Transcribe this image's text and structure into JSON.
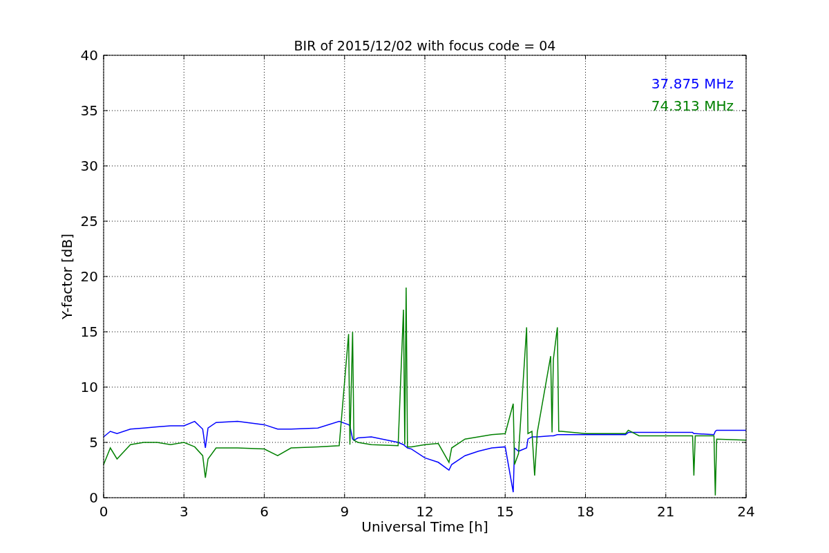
{
  "chart_data": {
    "type": "line",
    "title": "BIR of 2015/12/02 with focus code = 04",
    "xlabel": "Universal Time [h]",
    "ylabel": "Y-factor [dB]",
    "xlim": [
      0,
      24
    ],
    "ylim": [
      0,
      40
    ],
    "xticks": [
      0,
      3,
      6,
      9,
      12,
      15,
      18,
      21,
      24
    ],
    "yticks": [
      0,
      5,
      10,
      15,
      20,
      25,
      30,
      35,
      40
    ],
    "grid": true,
    "x": [
      0,
      0.25,
      0.5,
      1,
      1.5,
      2,
      2.5,
      3,
      3.4,
      3.7,
      3.8,
      3.9,
      4.2,
      5,
      6,
      6.5,
      7,
      8,
      8.8,
      9.15,
      9.2,
      9.3,
      9.35,
      9.5,
      10,
      11,
      11.2,
      11.25,
      11.3,
      11.35,
      11.5,
      12,
      12.5,
      12.9,
      13,
      13.5,
      14,
      14.5,
      15,
      15.3,
      15.35,
      15.5,
      15.8,
      15.85,
      16,
      16.1,
      16.2,
      16.7,
      16.75,
      16.8,
      16.95,
      17,
      17.1,
      18,
      19.5,
      19.6,
      20,
      21,
      22,
      22.05,
      22.1,
      22.8,
      22.85,
      22.9,
      24
    ],
    "series": [
      {
        "name": "37.875 MHz",
        "color": "#0000ff",
        "values": [
          5.5,
          6,
          5.8,
          6.2,
          6.3,
          6.4,
          6.5,
          6.5,
          6.9,
          6.2,
          4.5,
          6.3,
          6.8,
          6.9,
          6.6,
          6.2,
          6.2,
          6.3,
          6.9,
          6.6,
          6.5,
          5.3,
          5.2,
          5.4,
          5.5,
          5,
          4.8,
          4.7,
          4.6,
          4.5,
          4.4,
          3.6,
          3.2,
          2.5,
          3,
          3.8,
          4.2,
          4.5,
          4.6,
          0.5,
          4.5,
          4.2,
          4.5,
          5.3,
          5.5,
          5.5,
          5.5,
          5.6,
          5.6,
          5.6,
          5.7,
          5.7,
          5.7,
          5.7,
          5.7,
          5.9,
          5.9,
          5.9,
          5.9,
          5.8,
          5.8,
          5.7,
          6,
          6.1,
          6.1
        ]
      },
      {
        "name": "74.313 MHz",
        "color": "#008000",
        "values": [
          3,
          4.5,
          3.5,
          4.8,
          5,
          5,
          4.8,
          5,
          4.6,
          3.8,
          1.8,
          3.5,
          4.5,
          4.5,
          4.4,
          3.8,
          4.5,
          4.6,
          4.7,
          14.8,
          4.8,
          15,
          5.2,
          5,
          4.8,
          4.7,
          17,
          4.8,
          19,
          4.6,
          4.6,
          4.8,
          4.9,
          3.2,
          4.5,
          5.3,
          5.5,
          5.7,
          5.8,
          8.5,
          3,
          4,
          15.4,
          5.8,
          6,
          2,
          5.9,
          12.8,
          5.9,
          12.5,
          15.4,
          6,
          6,
          5.8,
          5.8,
          6.1,
          5.6,
          5.6,
          5.6,
          2,
          5.6,
          5.6,
          0.2,
          5.3,
          5.2
        ]
      }
    ]
  }
}
